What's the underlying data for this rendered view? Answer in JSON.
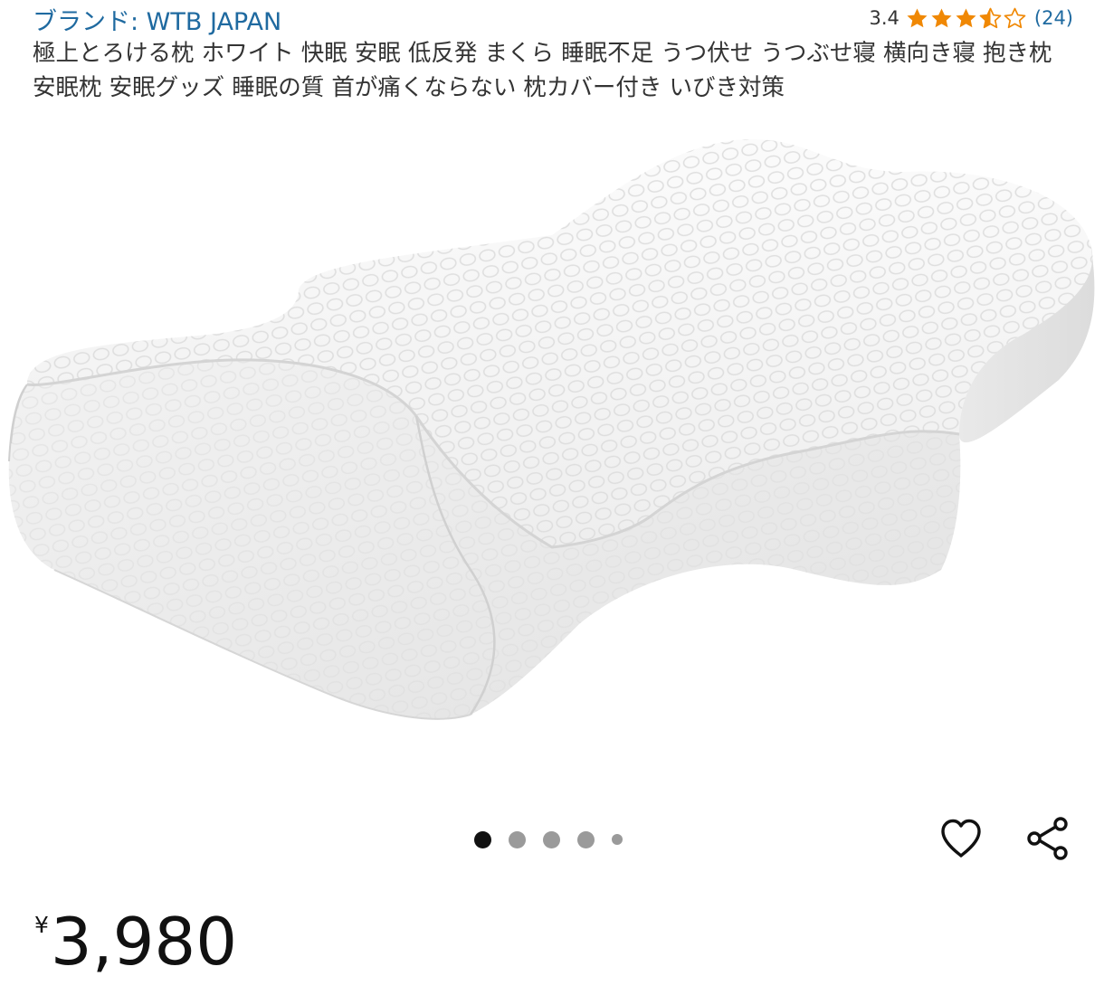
{
  "header": {
    "brand_label": "ブランド: WTB JAPAN",
    "rating_value": "3.4",
    "rating_count": "(24)",
    "star_rating": 3.4,
    "star_color": "#f08804",
    "link_color": "#1f6aa0"
  },
  "product": {
    "title": "極上とろける枕 ホワイト 快眠 安眠 低反発 まくら 睡眠不足 うつ伏せ うつぶせ寝 横向き寝 抱き枕 安眠枕 安眠グッズ 睡眠の質 首が痛くならない 枕カバー付き いびき対策",
    "image_icon": "pillow-photo"
  },
  "carousel": {
    "total_dots": 5,
    "active_index": 0
  },
  "actions": {
    "wishlist_icon": "heart-outline-icon",
    "share_icon": "share-icon"
  },
  "price": {
    "currency": "¥",
    "amount": "3,980"
  }
}
